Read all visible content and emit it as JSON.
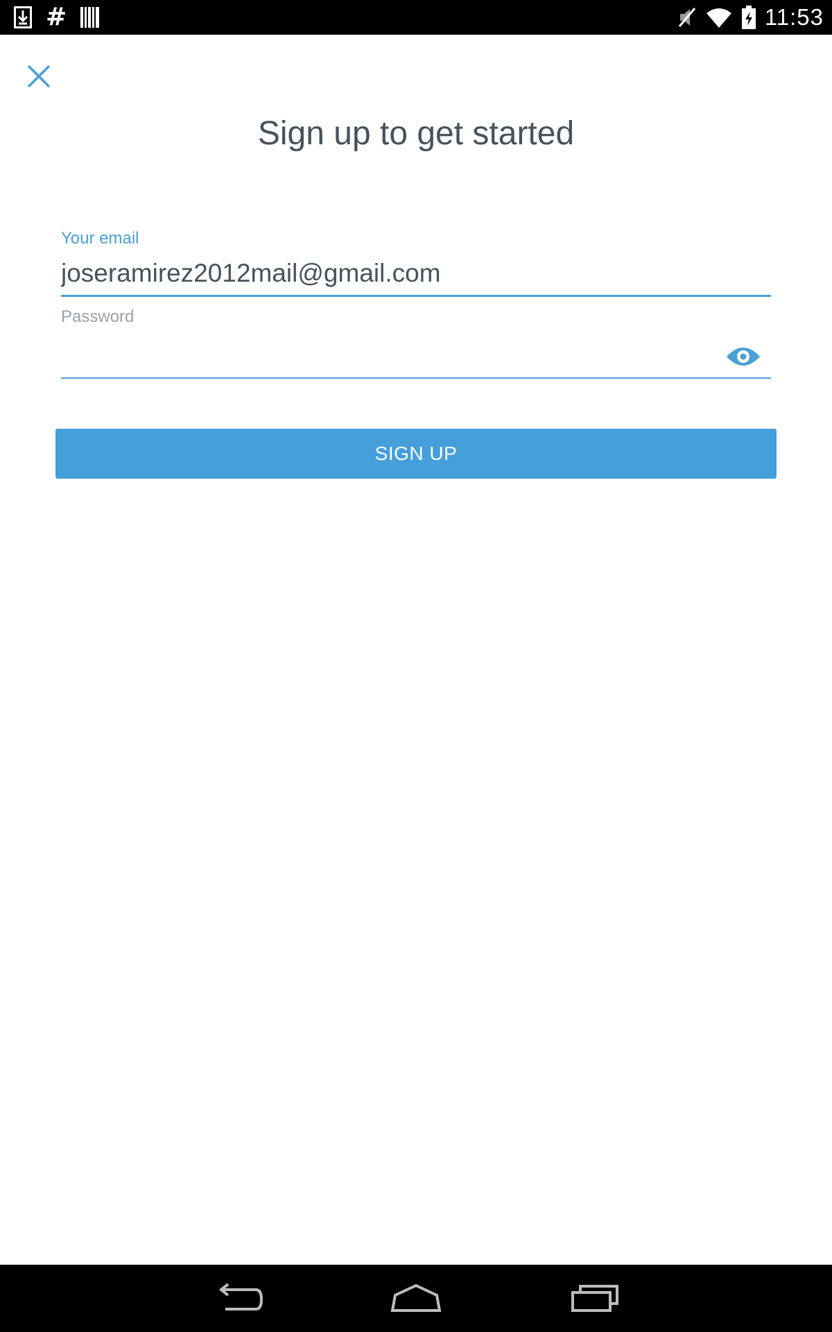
{
  "status_bar": {
    "time": "11:53",
    "left_icons": [
      "download-icon",
      "hash-icon",
      "barcode-icon"
    ],
    "right_icons": [
      "muted-icon",
      "wifi-icon",
      "battery-charging-icon"
    ],
    "hash_glyph": "#"
  },
  "header": {
    "close_icon": "close-icon",
    "title": "Sign up to get started"
  },
  "form": {
    "email": {
      "label": "Your email",
      "value": "joseramirez2012mail@gmail.com"
    },
    "password": {
      "label": "Password",
      "value": "",
      "toggle_icon": "eye-icon"
    },
    "submit_label": "SIGN UP"
  },
  "nav_bar": {
    "buttons": [
      "back-icon",
      "home-icon",
      "recents-icon"
    ]
  },
  "colors": {
    "accent": "#459fdb",
    "title_text": "#46525d",
    "label_inactive": "#9aa2a9",
    "bars": "#000000"
  }
}
